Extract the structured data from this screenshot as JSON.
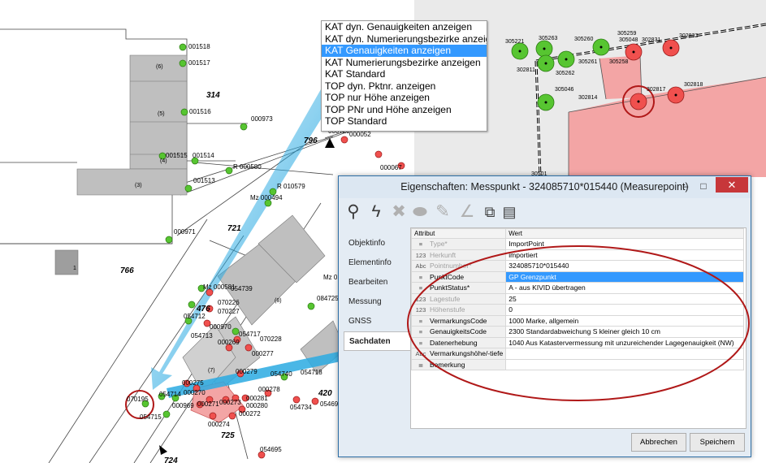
{
  "map": {
    "labels": {
      "p001518": "001518",
      "p001517": "001517",
      "p001516": "001516",
      "p001515": "001515",
      "p001514": "001514",
      "p001513": "001513",
      "p000973": "000973",
      "p000580": "R 000580",
      "p000579": "R 010579",
      "p000494": "Mz 000494",
      "p000971": "000971",
      "p000581": "Mz 000581",
      "p054739": "054739",
      "p070226": "070226",
      "p070227": "070227",
      "p054712": "054712",
      "p000970": "000970",
      "p054713": "054713",
      "p054717": "054717",
      "p070228": "070228",
      "p000269": "000269",
      "p000277": "000277",
      "p000279": "000279",
      "p054740": "054740",
      "p054718": "054718",
      "p000275": "000275",
      "p000278": "000278",
      "p054714": "054714",
      "p070270": "000270",
      "p070195": "070195",
      "p000969": "000969",
      "p000271": "000271",
      "p000273": "000273",
      "p000281": "000281",
      "p000280": "000280",
      "p000272": "000272",
      "p000274": "000274",
      "p054715": "054715",
      "p054734": "054734",
      "p054694": "054694",
      "p054695": "054695",
      "p084725": "084725",
      "p000052": "000052",
      "p000067": "000067",
      "p000729": "000729",
      "pMz": "Mz 0"
    },
    "parcels": {
      "n314": "314",
      "n796": "796",
      "n721": "721",
      "n766": "766",
      "n476": "476",
      "n420": "420",
      "n725": "725",
      "n724": "724"
    },
    "buildings": {
      "b6": "(6)",
      "b5": "(5)",
      "b4": "(4)",
      "b3": "(3)",
      "b1": "1",
      "b7": "(7)",
      "b8": "(8)"
    },
    "inset_labels": {
      "i305221": "305221",
      "i305263": "305263",
      "i305260": "305260",
      "i305259": "305259",
      "i305048": "305048",
      "i302831": "302831",
      "i302832": "302832",
      "i305261": "305261",
      "i305258": "305258",
      "i302811": "302811",
      "i305262": "305262",
      "i305046": "305046",
      "i302817": "302817",
      "i302818": "302818",
      "i302814": "302814",
      "i305011": "30501"
    }
  },
  "context_menu": {
    "items": [
      "KAT dyn. Genauigkeiten anzeigen",
      "KAT dyn. Numerierungsbezirke anzeigen",
      "KAT Genauigkeiten anzeigen",
      "KAT Numerierungsbezirke anzeigen",
      "KAT Standard",
      "TOP dyn. Pktnr. anzeigen",
      "TOP nur Höhe anzeigen",
      "TOP PNr und Höhe anzeigen",
      "TOP Standard"
    ],
    "selected_index": 2
  },
  "dialog": {
    "title": "Eigenschaften: Messpunkt - 324085710*015440 (Measurepoint)",
    "minimize_label": "–",
    "maximize_label": "□",
    "close_label": "✕",
    "toolbar_icons": [
      "search-icon",
      "lightning-icon",
      "delete-icon",
      "eraser-icon",
      "edit-pen-icon",
      "angle-icon",
      "copy-icon",
      "paste-icon"
    ],
    "tabs": [
      "Objektinfo",
      "Elementinfo",
      "Bearbeiten",
      "Messung",
      "GNSS",
      "Sachdaten"
    ],
    "active_tab": "Sachdaten",
    "table_headers": {
      "attr": "Attribut",
      "value": "Wert"
    },
    "rows": [
      {
        "icon": "≡",
        "name": "Type*",
        "value": "ImportPoint",
        "dim": true
      },
      {
        "icon": "123",
        "name": "Herkunft",
        "value": "importiert",
        "dim": true
      },
      {
        "icon": "Abc",
        "name": "Pointnumber*",
        "value": "324085710*015440",
        "dim": true
      },
      {
        "icon": "≡",
        "name": "PunktCode",
        "value": "GP Grenzpunkt",
        "dim": false,
        "selected": true
      },
      {
        "icon": "≡",
        "name": "PunktStatus*",
        "value": "A - aus KIVID übertragen",
        "dim": false
      },
      {
        "icon": "123",
        "name": "Lagestufe",
        "value": "25",
        "dim": true
      },
      {
        "icon": "123",
        "name": "Höhenstufe",
        "value": "0",
        "dim": true
      },
      {
        "icon": "≡",
        "name": "VermarkungsCode",
        "value": "1000 Marke, allgemein",
        "dim": false
      },
      {
        "icon": "≡",
        "name": "GenauigkeitsCode",
        "value": "2300 Standardabweichung S kleiner gleich 10 cm",
        "dim": false
      },
      {
        "icon": "≡",
        "name": "Datenerhebung",
        "value": "1040 Aus Katastervermessung mit unzureichender Lagegenauigkeit (NW)",
        "dim": false
      },
      {
        "icon": "Abc",
        "name": "Vermarkungshöhe/-tiefe",
        "value": "",
        "dim": false
      },
      {
        "icon": "≣",
        "name": "Bemerkung",
        "value": "",
        "dim": false
      }
    ],
    "buttons": {
      "cancel": "Abbrechen",
      "save": "Speichern"
    }
  },
  "colors": {
    "point_green": "#57c531",
    "point_red": "#f0504e",
    "highlight_red": "#b01818",
    "arrow_blue": "#2aaae2",
    "selection_blue": "#3399ff",
    "building_gray": "#bfbfbf",
    "inset_bg": "#eaeaea",
    "parcel_pink": "#f3a5a5"
  }
}
